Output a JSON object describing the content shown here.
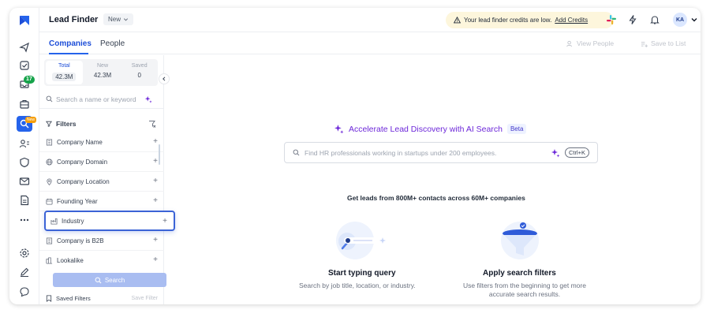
{
  "app": {
    "title": "Lead Finder",
    "mode_pill": "New",
    "credits_notice": "Your lead finder credits are low.",
    "credits_link": "Add Credits",
    "avatar_initials": "KA"
  },
  "rail": {
    "inbox_badge": "17",
    "search_badge": "New"
  },
  "tabs": {
    "items": [
      "Companies",
      "People"
    ],
    "active": "Companies",
    "view_people": "View People",
    "save_to_list": "Save to List"
  },
  "stats": [
    {
      "label": "Total",
      "value": "42.3M"
    },
    {
      "label": "New",
      "value": "42.3M"
    },
    {
      "label": "Saved",
      "value": "0"
    }
  ],
  "search": {
    "placeholder": "Search a name or keyword"
  },
  "filters": {
    "heading": "Filters",
    "items": [
      {
        "label": "Company Name",
        "icon": "building-icon"
      },
      {
        "label": "Company Domain",
        "icon": "globe-icon"
      },
      {
        "label": "Company Location",
        "icon": "pin-icon"
      },
      {
        "label": "Founding Year",
        "icon": "calendar-icon"
      },
      {
        "label": "Industry",
        "icon": "factory-icon"
      },
      {
        "label": "Company is B2B",
        "icon": "building-icon"
      },
      {
        "label": "Lookalike",
        "icon": "lookalike-icon"
      }
    ],
    "highlighted": "Industry",
    "search_button": "Search",
    "saved_filters": "Saved Filters",
    "save_filter": "Save Filter"
  },
  "main": {
    "ai_title": "Accelerate Lead Discovery with AI Search",
    "beta": "Beta",
    "ai_placeholder": "Find HR professionals working in startups under 200 employees.",
    "shortcut": "Ctrl+K",
    "leads_text": "Get leads from 800M+ contacts across 60M+ companies",
    "cards": [
      {
        "title": "Start typing query",
        "subtitle": "Search by job title, location, or industry."
      },
      {
        "title": "Apply search filters",
        "subtitle_line1": "Use filters from the beginning to get more",
        "subtitle_line2": "accurate search results."
      }
    ]
  },
  "colors": {
    "accent": "#2563eb",
    "ai_purple": "#6d28d9",
    "badge_green": "#16a34a",
    "credits_bg": "#fdf6dc"
  }
}
